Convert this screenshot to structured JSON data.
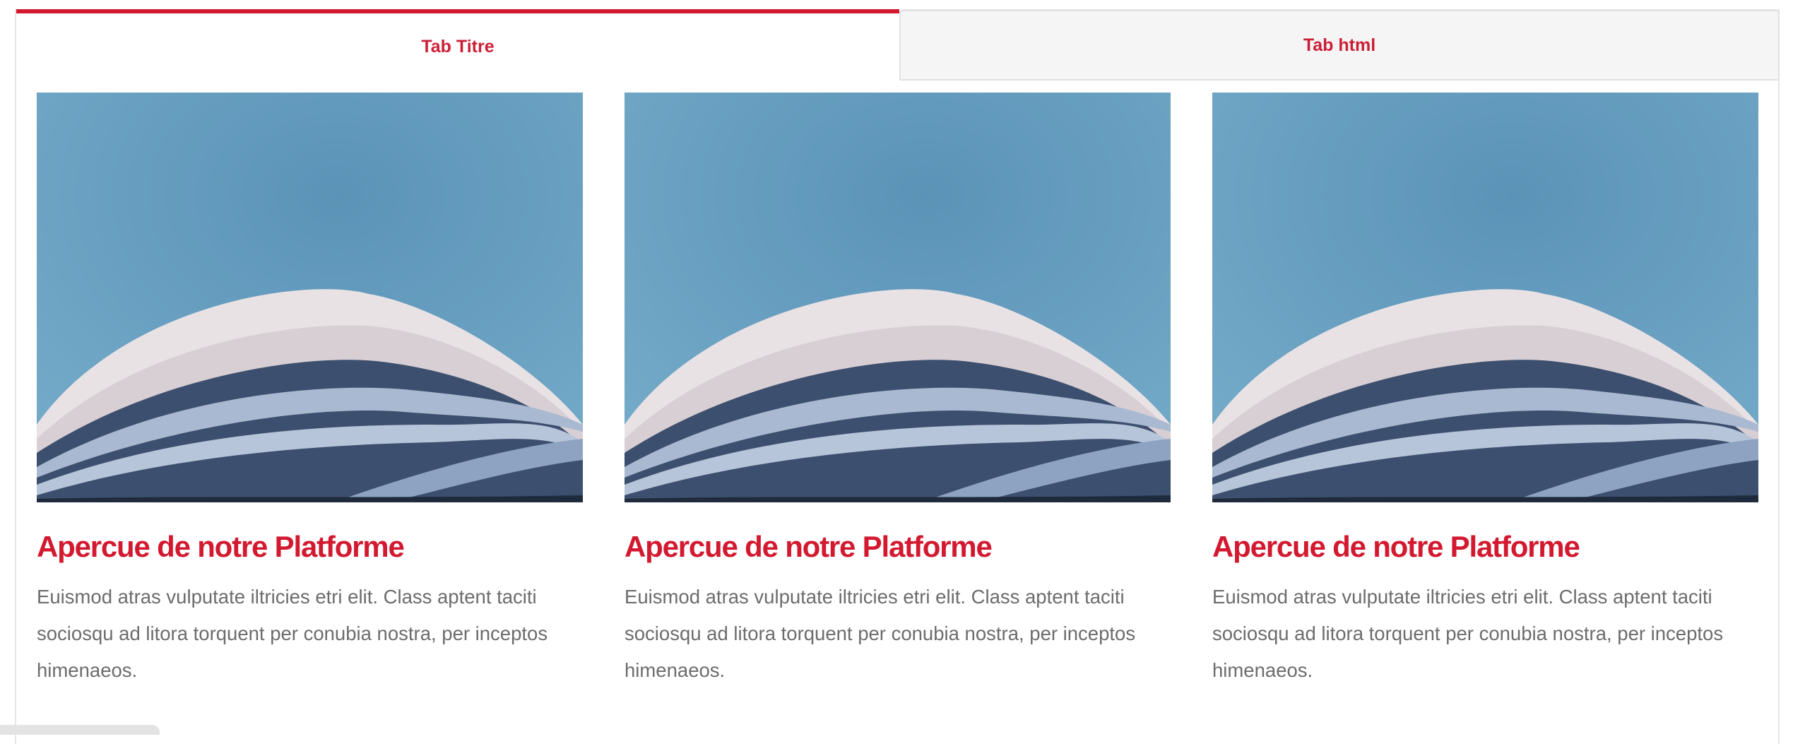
{
  "tabs": [
    {
      "label": "Tab Titre",
      "active": true
    },
    {
      "label": "Tab html",
      "active": false
    }
  ],
  "cards": [
    {
      "title": "Apercue de notre Platforme",
      "text": "Euismod atras vulputate iltricies etri elit. Class aptent taciti sociosqu ad litora torquent per conubia nostra, per inceptos himenaeos."
    },
    {
      "title": "Apercue de notre Platforme",
      "text": "Euismod atras vulputate iltricies etri elit. Class aptent taciti sociosqu ad litora torquent per conubia nostra, per inceptos himenaeos."
    },
    {
      "title": "Apercue de notre Platforme",
      "text": "Euismod atras vulputate iltricies etri elit. Class aptent taciti sociosqu ad litora torquent per conubia nostra, per inceptos himenaeos."
    }
  ],
  "colors": {
    "accent": "#d3192f",
    "body_text": "#6c6c6c",
    "inactive_tab_bg": "#f5f5f5"
  }
}
